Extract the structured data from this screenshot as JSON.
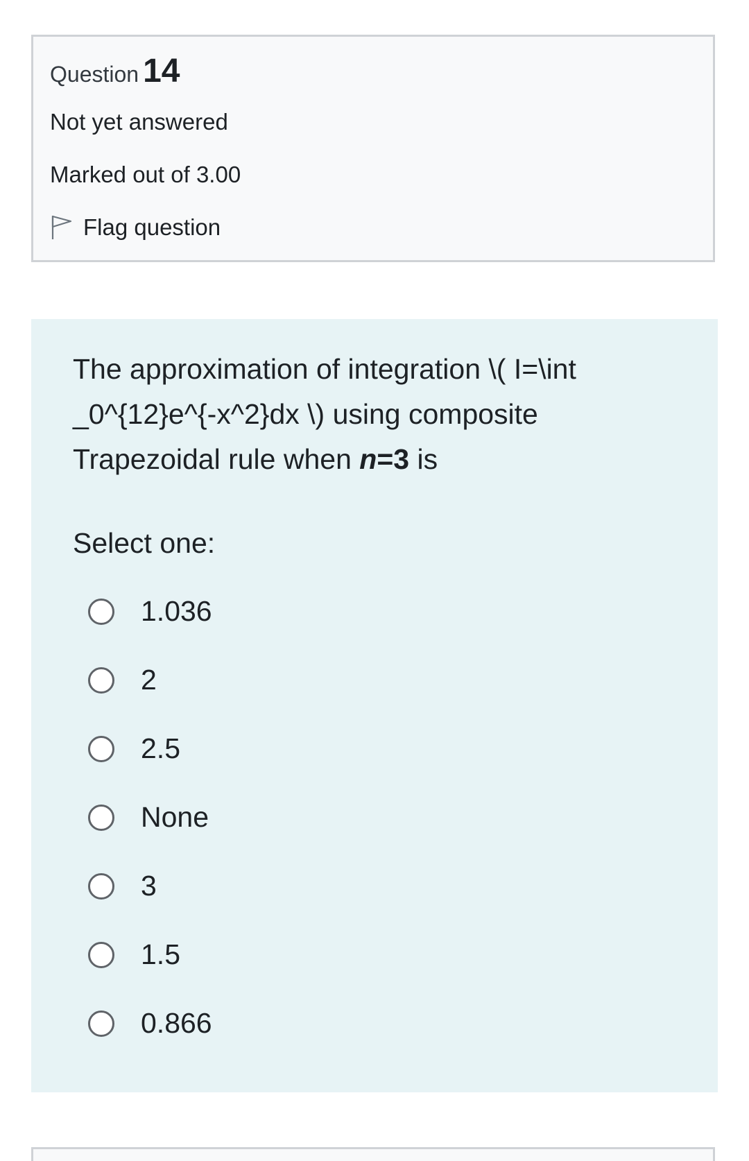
{
  "info": {
    "question_prefix": "Question",
    "question_number": "14",
    "state": "Not yet answered",
    "grade": "Marked out of 3.00",
    "flag_label": "Flag question",
    "flag_icon": "flag-outline-icon"
  },
  "question": {
    "text_part1": "The approximation of integration \\( I=\\int _0^{12}e^{-x^2}dx \\) using composite Trapezoidal rule when ",
    "n_var": "n",
    "equals": "=",
    "n_value": "3",
    "text_part2": " is",
    "prompt": "Select one:",
    "options": [
      "1.036",
      "2",
      "2.5",
      "None",
      "3",
      "1.5",
      "0.866"
    ],
    "selected": null
  },
  "colors": {
    "info_bg": "#f8f9fa",
    "info_border": "#cfd2d6",
    "content_bg": "#e7f3f5",
    "text": "#1d2125"
  }
}
